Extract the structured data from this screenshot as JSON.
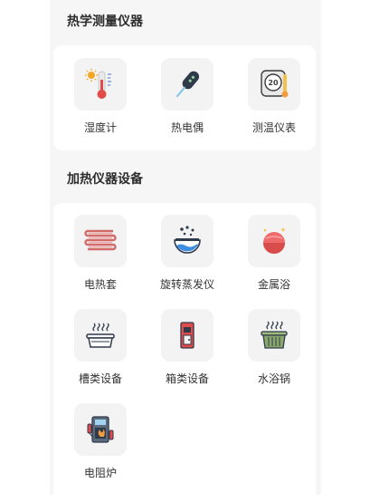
{
  "sections": [
    {
      "title": "热学测量仪器",
      "items": [
        {
          "label": "湿度计",
          "icon": "thermometer-icon"
        },
        {
          "label": "热电偶",
          "icon": "thermocouple-icon"
        },
        {
          "label": "测温仪表",
          "icon": "thermostat-gauge-icon"
        }
      ]
    },
    {
      "title": "加热仪器设备",
      "items": [
        {
          "label": "电热套",
          "icon": "heating-mantle-icon"
        },
        {
          "label": "旋转蒸发仪",
          "icon": "rotary-evaporator-icon"
        },
        {
          "label": "金属浴",
          "icon": "metal-bath-icon"
        },
        {
          "label": "槽类设备",
          "icon": "tank-equipment-icon"
        },
        {
          "label": "箱类设备",
          "icon": "box-equipment-icon"
        },
        {
          "label": "水浴锅",
          "icon": "water-bath-icon"
        },
        {
          "label": "电阻炉",
          "icon": "resistance-furnace-icon"
        }
      ]
    }
  ],
  "gauge_reading": "20",
  "colors": {
    "panel": "#f6f6f6",
    "card": "#ffffff",
    "tile": "#f3f3f3",
    "title": "#2c2c2c",
    "label": "#333333"
  }
}
